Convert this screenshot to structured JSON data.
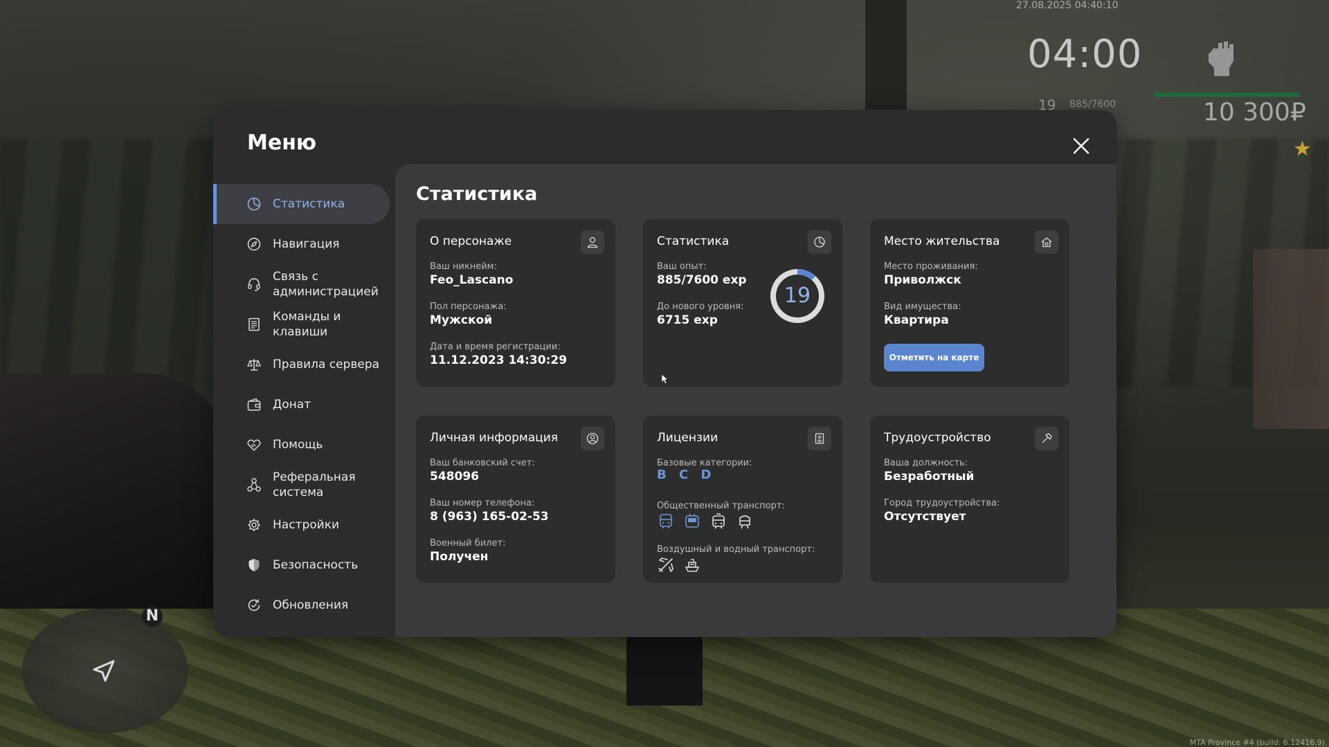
{
  "hud": {
    "date": "27.08.2025 04:40:10",
    "time": "04:00",
    "level": "19",
    "exp": "885/7600",
    "money": "10 300₽",
    "minimap_north": "N",
    "build_info": "MTA Province #4 (build: 6.12416.9)"
  },
  "menu": {
    "title": "Меню",
    "sidebar": [
      {
        "label": "Статистика",
        "icon": "pie-chart-icon",
        "active": true
      },
      {
        "label": "Навигация",
        "icon": "compass-icon"
      },
      {
        "label": "Связь с\nадминистрацией",
        "icon": "headset-icon"
      },
      {
        "label": "Команды и\nклавиши",
        "icon": "document-icon"
      },
      {
        "label": "Правила сервера",
        "icon": "scales-icon"
      },
      {
        "label": "Донат",
        "icon": "wallet-icon"
      },
      {
        "label": "Помощь",
        "icon": "handshake-heart-icon"
      },
      {
        "label": "Реферальная\nсистема",
        "icon": "network-icon"
      },
      {
        "label": "Настройки",
        "icon": "gear-icon"
      },
      {
        "label": "Безопасность",
        "icon": "shield-icon"
      },
      {
        "label": "Обновления",
        "icon": "refresh-check-icon"
      }
    ]
  },
  "content": {
    "title": "Статистика",
    "about": {
      "title": "О персонаже",
      "nickname_label": "Ваш никнейм:",
      "nickname": "Feo_Lascano",
      "gender_label": "Пол персонажа:",
      "gender": "Мужской",
      "reg_label": "Дата и время регистрации:",
      "reg": "11.12.2023 14:30:29"
    },
    "stats": {
      "title": "Статистика",
      "exp_label": "Ваш опыт:",
      "exp": "885/7600 exp",
      "next_label": "До нового уровня:",
      "next": "6715 exp",
      "level": "19",
      "progress": 0.1164
    },
    "residence": {
      "title": "Место жительства",
      "place_label": "Место проживания:",
      "place": "Приволжск",
      "type_label": "Вид имущества:",
      "type": "Квартира",
      "button": "Отметить на карте"
    },
    "personal": {
      "title": "Личная информация",
      "bank_label": "Ваш банковский счет:",
      "bank": "548096",
      "phone_label": "Ваш номер телефона:",
      "phone": "8 (963) 165-02-53",
      "military_label": "Военный билет:",
      "military": "Получен"
    },
    "licenses": {
      "title": "Лицензии",
      "base_label": "Базовые категории:",
      "base": [
        "B",
        "C",
        "D"
      ],
      "public_label": "Общественный транспорт:",
      "air_label": "Воздушный и водный транспорт:"
    },
    "employment": {
      "title": "Трудоустройство",
      "position_label": "Ваша должность:",
      "position": "Безработный",
      "city_label": "Город трудоустройства:",
      "city": "Отсутствует"
    }
  },
  "colors": {
    "accent": "#6a92d6",
    "license_blue": "#6d96db",
    "button": "#5a86d0"
  }
}
